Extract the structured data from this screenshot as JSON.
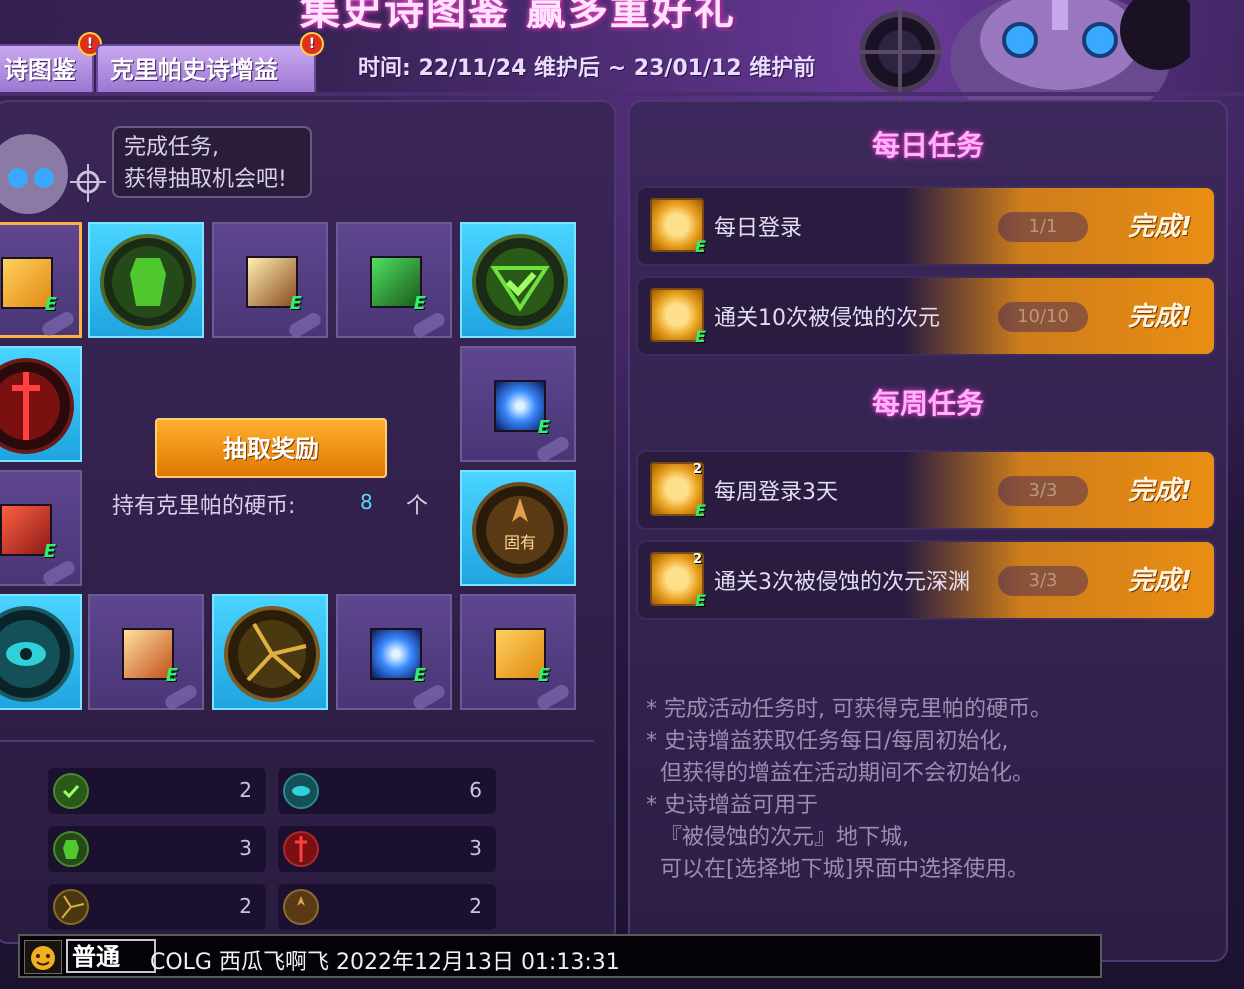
{
  "header": {
    "banner_title": "集史诗图鉴 赢多重好礼",
    "tabs": [
      {
        "label": "诗图鉴",
        "alert": "!"
      },
      {
        "label": "克里帕史诗增益",
        "alert": "!"
      }
    ],
    "period": "时间: 22/11/24 维护后 ~ 23/01/12 维护前"
  },
  "left": {
    "speech_lines": [
      "完成任务,",
      "获得抽取机会吧!"
    ],
    "draw_button": "抽取奖励",
    "coins_label": "持有克里帕的硬币:",
    "coins_value": "8",
    "coins_unit": "个",
    "emblem_text": "固有",
    "stats": [
      {
        "icon": "green-check-emblem-icon",
        "value": "2"
      },
      {
        "icon": "teal-eye-emblem-icon",
        "value": "6"
      },
      {
        "icon": "green-armor-emblem-icon",
        "value": "3"
      },
      {
        "icon": "red-sword-emblem-icon",
        "value": "3"
      },
      {
        "icon": "gold-dial-emblem-icon",
        "value": "2"
      },
      {
        "icon": "bronze-crest-emblem-icon",
        "value": "2"
      }
    ]
  },
  "right": {
    "daily_title": "每日任务",
    "weekly_title": "每周任务",
    "tasks": [
      {
        "name": "每日登录",
        "progress": "1/1",
        "status": "完成!",
        "badge": ""
      },
      {
        "name": "通关10次被侵蚀的次元",
        "progress": "10/10",
        "status": "完成!",
        "badge": ""
      },
      {
        "name": "每周登录3天",
        "progress": "3/3",
        "status": "完成!",
        "badge": "2"
      },
      {
        "name": "通关3次被侵蚀的次元深渊",
        "progress": "3/3",
        "status": "完成!",
        "badge": "2"
      }
    ],
    "notes": [
      "* 完成活动任务时, 可获得克里帕的硬币。",
      "* 史诗增益获取任务每日/每周初始化,",
      "  但获得的增益在活动期间不会初始化。",
      "* 史诗增益可用于",
      "  『被侵蚀的次元』地下城,",
      "  可以在[选择地下城]界面中选择使用。"
    ]
  },
  "chat": {
    "channel": "普通",
    "message": "COLG 西瓜飞啊飞 2022年12月13日 01:13:31"
  },
  "item_mark": "E"
}
